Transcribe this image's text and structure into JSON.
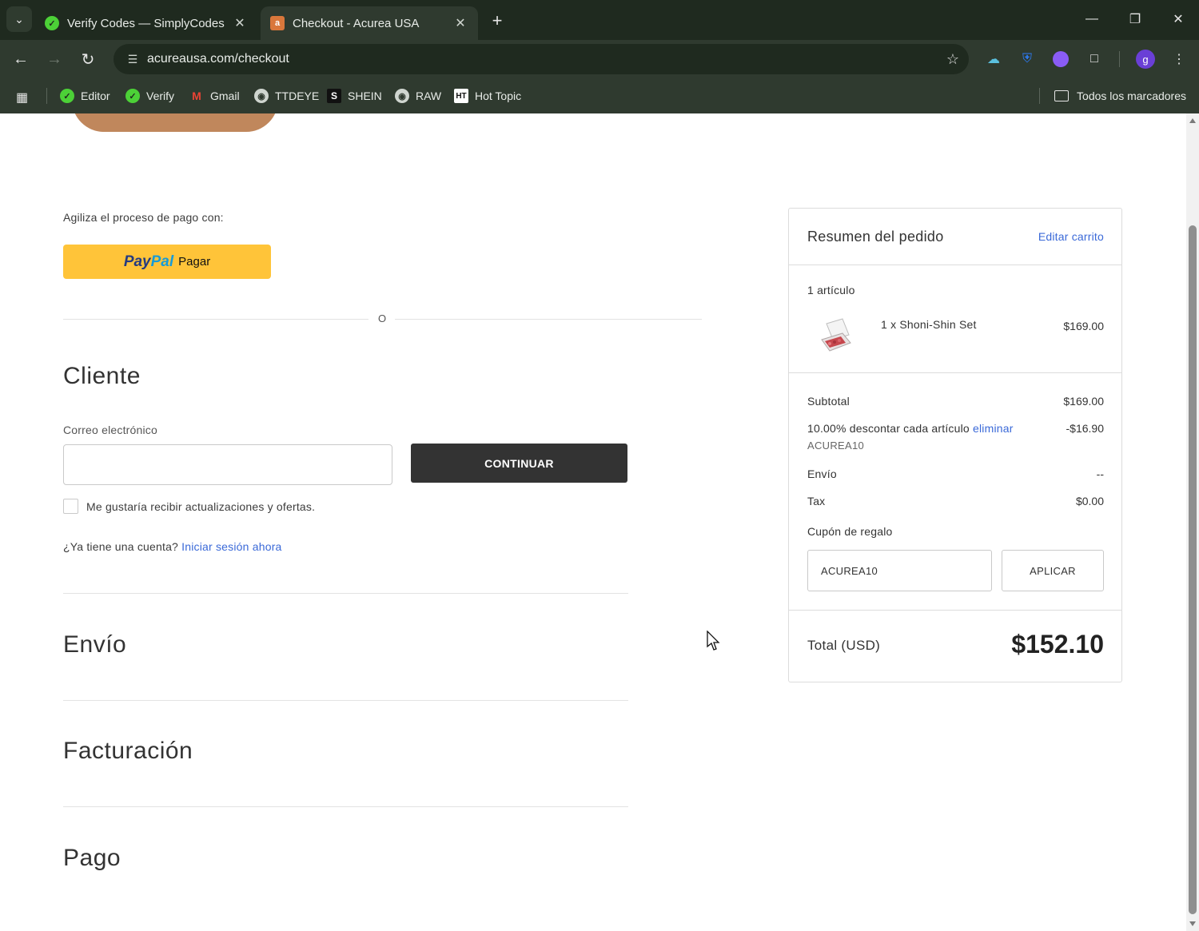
{
  "browser": {
    "tabs": [
      {
        "title": "Verify Codes — SimplyCodes",
        "active": false
      },
      {
        "title": "Checkout - Acurea USA",
        "active": true
      }
    ],
    "url": "acureausa.com/checkout",
    "profile_initial": "g",
    "bookmarks": [
      {
        "label": "Editor",
        "icon": "simplycodes-icon"
      },
      {
        "label": "Verify",
        "icon": "simplycodes-icon"
      },
      {
        "label": "Gmail",
        "icon": "gmail-icon"
      },
      {
        "label": "TTDEYE",
        "icon": "globe-icon"
      },
      {
        "label": "SHEIN",
        "icon": "shein-icon"
      },
      {
        "label": "RAW",
        "icon": "globe-icon"
      },
      {
        "label": "Hot Topic",
        "icon": "hottopic-icon"
      }
    ],
    "bookmarks_folder": "Todos los marcadores"
  },
  "checkout": {
    "express_label": "Agiliza el proceso de pago con:",
    "paypal": {
      "logo_pay": "Pay",
      "logo_pal": "Pal",
      "label": "Pagar"
    },
    "or_divider": "O",
    "customer": {
      "title": "Cliente",
      "email_label": "Correo electrónico",
      "email_value": "",
      "continue_label": "CONTINUAR",
      "newsletter_label": "Me gustaría recibir actualizaciones y ofertas.",
      "account_prompt": "¿Ya tiene una cuenta?",
      "signin_link": "Iniciar sesión ahora"
    },
    "sections": [
      "Envío",
      "Facturación",
      "Pago"
    ]
  },
  "summary": {
    "title": "Resumen del pedido",
    "edit_link": "Editar carrito",
    "item_count": "1 artículo",
    "items": [
      {
        "name": "1 x Shoni-Shin Set",
        "price": "$169.00"
      }
    ],
    "subtotal_label": "Subtotal",
    "subtotal_value": "$169.00",
    "discount_label": "10.00% descontar cada artículo",
    "discount_remove": "eliminar",
    "discount_value": "-$16.90",
    "discount_code": "ACUREA10",
    "shipping_label": "Envío",
    "shipping_value": "--",
    "tax_label": "Tax",
    "tax_value": "$0.00",
    "gift_label": "Cupón de regalo",
    "gift_input": "ACUREA10",
    "gift_button": "APLICAR",
    "total_label": "Total (USD)",
    "total_value": "$152.10"
  },
  "colors": {
    "paypal_yellow": "#ffc439",
    "continue_button": "#333333",
    "link_blue": "#3a69d8",
    "chrome_dark": "#1f2a1f"
  }
}
